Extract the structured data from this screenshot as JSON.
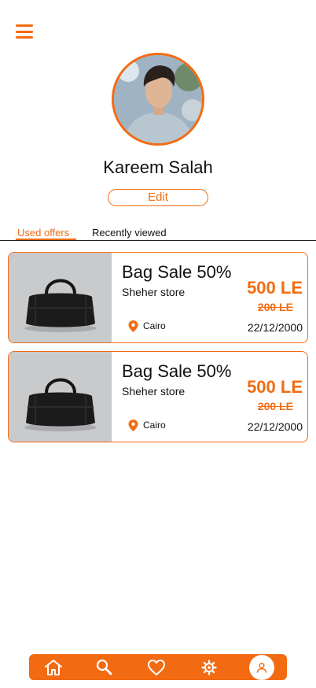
{
  "header": {
    "menu_icon": "hamburger-menu-icon"
  },
  "profile": {
    "name": "Kareem Salah",
    "edit_label": "Edit",
    "avatar_icon": "profile-photo"
  },
  "tabs": [
    {
      "label": "Used offers",
      "active": true
    },
    {
      "label": "Recently viewed",
      "active": false
    }
  ],
  "offers": [
    {
      "title": "Bag Sale 50%",
      "store": "Sheher store",
      "price": "500 LE",
      "old_price": "200 LE",
      "location": "Cairo",
      "date": "22/12/2000",
      "image_icon": "duffel-bag-image",
      "location_icon": "location-pin-icon"
    },
    {
      "title": "Bag Sale 50%",
      "store": "Sheher store",
      "price": "500 LE",
      "old_price": "200 LE",
      "location": "Cairo",
      "date": "22/12/2000",
      "image_icon": "duffel-bag-image",
      "location_icon": "location-pin-icon"
    }
  ],
  "bottom_nav": {
    "items": [
      {
        "icon": "home-icon"
      },
      {
        "icon": "search-icon"
      },
      {
        "icon": "heart-icon"
      },
      {
        "icon": "settings-gear-icon"
      },
      {
        "icon": "profile-icon",
        "active": true
      }
    ]
  },
  "colors": {
    "accent": "#F26B12",
    "text": "#111111",
    "background": "#FFFFFF"
  }
}
